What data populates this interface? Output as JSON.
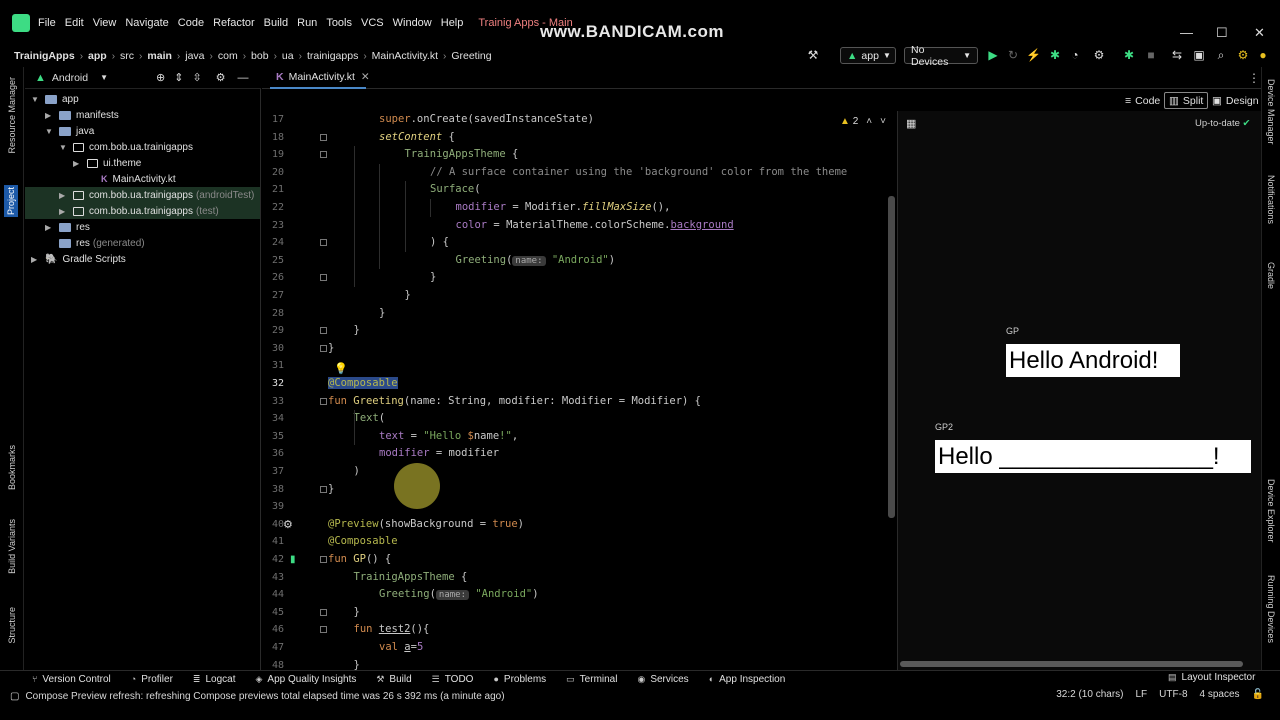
{
  "menubar": {
    "items": [
      "File",
      "Edit",
      "View",
      "Navigate",
      "Code",
      "Refactor",
      "Build",
      "Run",
      "Tools",
      "VCS",
      "Window",
      "Help"
    ],
    "title": "Trainig Apps - Main",
    "watermark": "www.BANDICAM.com"
  },
  "breadcrumb": [
    "TrainigApps",
    "app",
    "src",
    "main",
    "java",
    "com",
    "bob",
    "ua",
    "trainigapps",
    "MainActivity.kt",
    "Greeting"
  ],
  "toolbar": {
    "run_config": "app",
    "device": "No Devices"
  },
  "left_strip": [
    "Resource Manager",
    "Project",
    "Bookmarks",
    "Build Variants",
    "Structure"
  ],
  "right_strip": [
    "Device Manager",
    "Notifications",
    "Gradle",
    "Device Explorer",
    "Running Devices"
  ],
  "project": {
    "view": "Android",
    "tree": [
      {
        "label": "app",
        "extra": "",
        "level": 0,
        "kind": "folder",
        "expanded": true
      },
      {
        "label": "manifests",
        "extra": "",
        "level": 1,
        "kind": "folder",
        "expanded": false
      },
      {
        "label": "java",
        "extra": "",
        "level": 1,
        "kind": "folder",
        "expanded": true
      },
      {
        "label": "com.bob.ua.trainigapps",
        "extra": "",
        "level": 2,
        "kind": "pkg",
        "expanded": true
      },
      {
        "label": "ui.theme",
        "extra": "",
        "level": 3,
        "kind": "pkg",
        "expanded": false
      },
      {
        "label": "MainActivity.kt",
        "extra": "",
        "level": 4,
        "kind": "file",
        "expanded": null
      },
      {
        "label": "com.bob.ua.trainigapps",
        "extra": "(androidTest)",
        "level": 2,
        "kind": "pkg",
        "expanded": false
      },
      {
        "label": "com.bob.ua.trainigapps",
        "extra": "(test)",
        "level": 2,
        "kind": "pkg",
        "expanded": false
      },
      {
        "label": "res",
        "extra": "",
        "level": 1,
        "kind": "folder",
        "expanded": false
      },
      {
        "label": "res",
        "extra": "(generated)",
        "level": 1,
        "kind": "folder",
        "expanded": null
      },
      {
        "label": "Gradle Scripts",
        "extra": "",
        "level": 0,
        "kind": "gradle",
        "expanded": false
      }
    ]
  },
  "editor": {
    "tab": "MainActivity.kt",
    "modes": [
      "Code",
      "Split",
      "Design"
    ],
    "warnings": "2",
    "current_line": "32",
    "lines": [
      {
        "n": "17",
        "html": "<span class='kw'>super</span>.onCreate(savedInstanceState)",
        "indent": 2
      },
      {
        "n": "18",
        "html": "<span class='fn' style='font-style:italic'>setContent</span> {",
        "indent": 2
      },
      {
        "n": "19",
        "html": "<span class='gr'>TrainigAppsTheme</span> {",
        "indent": 3
      },
      {
        "n": "20",
        "html": "<span class='cm'>// A surface container using the 'background' color from the theme</span>",
        "indent": 4
      },
      {
        "n": "21",
        "html": "<span class='gr'>Surface</span>(",
        "indent": 4
      },
      {
        "n": "22",
        "html": "<span class='pr'>modifier</span> = Modifier.<span class='fn' style='font-style:italic'>fillMaxSize</span>(),",
        "indent": 5
      },
      {
        "n": "23",
        "html": "<span class='pr'>color</span> = MaterialTheme.colorScheme.<span class='pr' style='text-decoration:underline'>background</span>",
        "indent": 5
      },
      {
        "n": "24",
        "html": ") {",
        "indent": 4
      },
      {
        "n": "25",
        "html": "<span class='gr'>Greeting</span>(<span class='hint'>name:</span> <span class='str'>\"Android\"</span>)",
        "indent": 5
      },
      {
        "n": "26",
        "html": "}",
        "indent": 4
      },
      {
        "n": "27",
        "html": "}",
        "indent": 3
      },
      {
        "n": "28",
        "html": "}",
        "indent": 2
      },
      {
        "n": "29",
        "html": "}",
        "indent": 1
      },
      {
        "n": "30",
        "html": "}",
        "indent": 0
      },
      {
        "n": "31",
        "html": "",
        "indent": 0
      },
      {
        "n": "32",
        "html": "<span class='an' style='background:#2b4a8a'>@Composable</span>",
        "indent": 0
      },
      {
        "n": "33",
        "html": "<span class='kw'>fun</span> <span class='fn'>Greeting</span>(name: String, modifier: Modifier = Modifier) {",
        "indent": 0
      },
      {
        "n": "34",
        "html": "<span class='gr'>Text</span>(",
        "indent": 1
      },
      {
        "n": "35",
        "html": "<span class='pr'>text</span> = <span class='str'>\"Hello </span><span class='kw'>$</span>name<span class='str'>!\"</span>,",
        "indent": 2
      },
      {
        "n": "36",
        "html": "<span class='pr'>modifier</span> = modifier",
        "indent": 2
      },
      {
        "n": "37",
        "html": ")",
        "indent": 1
      },
      {
        "n": "38",
        "html": "}",
        "indent": 0
      },
      {
        "n": "39",
        "html": "",
        "indent": 0
      },
      {
        "n": "40",
        "html": "<span class='an'>@Preview</span>(showBackground = <span class='kw'>true</span>)",
        "indent": 0
      },
      {
        "n": "41",
        "html": "<span class='an'>@Composable</span>",
        "indent": 0
      },
      {
        "n": "42",
        "html": "<span class='kw'>fun</span> <span class='fn'>GP</span>() {",
        "indent": 0
      },
      {
        "n": "43",
        "html": "<span class='gr'>TrainigAppsTheme</span> {",
        "indent": 1
      },
      {
        "n": "44",
        "html": "<span class='gr'>Greeting</span>(<span class='hint'>name:</span> <span class='str'>\"Android\"</span>)",
        "indent": 2
      },
      {
        "n": "45",
        "html": "}",
        "indent": 1
      },
      {
        "n": "46",
        "html": "<span class='kw'>fun</span> <span style='text-decoration:underline'>test2</span>(){",
        "indent": 1
      },
      {
        "n": "47",
        "html": "<span class='kw'>val</span> <span style='text-decoration:underline'>a</span>=<span class='pr'>5</span>",
        "indent": 2
      },
      {
        "n": "48",
        "html": "}",
        "indent": 1
      }
    ]
  },
  "preview": {
    "status": "Up-to-date",
    "items": [
      {
        "label": "GP",
        "text": "Hello Android!"
      },
      {
        "label": "GP2",
        "text": "Hello ________________!"
      }
    ]
  },
  "bottom_tools": [
    "Version Control",
    "Profiler",
    "Logcat",
    "App Quality Insights",
    "Build",
    "TODO",
    "Problems",
    "Terminal",
    "Services",
    "App Inspection"
  ],
  "layout_inspector": "Layout Inspector",
  "status": {
    "message": "Compose Preview refresh: refreshing Compose previews total elapsed time was 26 s 392 ms (a minute ago)",
    "position": "32:2 (10 chars)",
    "line_sep": "LF",
    "encoding": "UTF-8",
    "indent": "4 spaces"
  },
  "colors": {
    "accent": "#4a88c7",
    "current_line": "#002080",
    "android_green": "#3ddc84"
  }
}
